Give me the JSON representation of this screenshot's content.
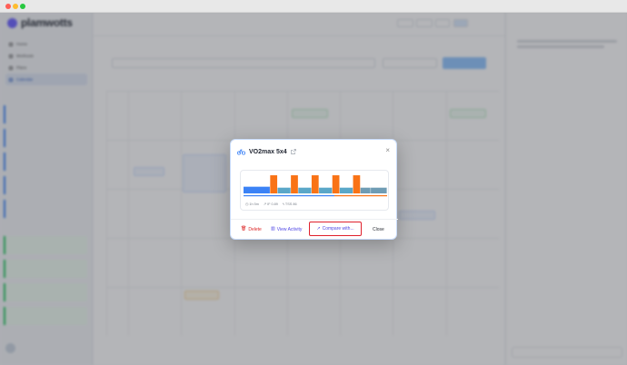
{
  "brand": {
    "name": "plamwotts"
  },
  "sidebar": {
    "nav": [
      "Home",
      "Workouts",
      "Plans",
      "Calendar"
    ],
    "active_index": 3
  },
  "modal": {
    "title": "VO2max 5x4",
    "close_symbol": "×",
    "workout_chart": {
      "type": "bar",
      "values": [
        0.35,
        0.95,
        0.3,
        0.95,
        0.3,
        0.95,
        0.3,
        0.95,
        0.3,
        0.95,
        0.3,
        0.3
      ],
      "kinds": [
        "warmup",
        "interval",
        "recovery",
        "interval",
        "recovery",
        "interval",
        "recovery",
        "interval",
        "recovery",
        "interval",
        "cooldown",
        "cooldown"
      ],
      "colors": {
        "warmup": "#3b82f6",
        "interval": "#f97316",
        "recovery": "#5aa7c8",
        "cooldown": "#6f9cb4"
      }
    },
    "stats": [
      {
        "icon": "clock-icon",
        "text": "1h 5m"
      },
      {
        "icon": "trend-icon",
        "text": "IF 0.89"
      },
      {
        "icon": "bolt-icon",
        "text": "TSS 86"
      }
    ],
    "actions": {
      "delete_label": "Delete",
      "view_label": "View Activity",
      "compare_label": "Compare with...",
      "close_label": "Close"
    },
    "colors": {
      "accent": "#4f46e5",
      "danger": "#dc2626",
      "highlight_box": "#e0202c"
    }
  }
}
